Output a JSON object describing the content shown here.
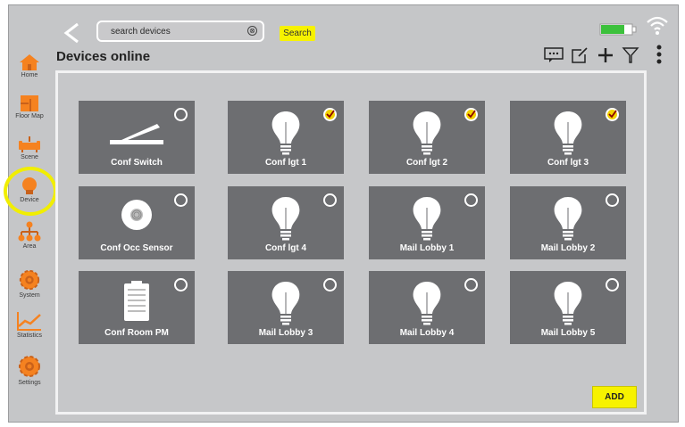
{
  "header": {
    "search_placeholder": "search devices",
    "search_button": "Search",
    "title": "Devices online"
  },
  "sidebar": {
    "items": [
      {
        "label": "Home",
        "icon": "home-icon"
      },
      {
        "label": "Floor Map",
        "icon": "floor-map-icon"
      },
      {
        "label": "Scene",
        "icon": "scene-icon"
      },
      {
        "label": "Device",
        "icon": "device-icon",
        "active": true
      },
      {
        "label": "Area",
        "icon": "area-icon"
      },
      {
        "label": "System",
        "icon": "system-gear-icon"
      },
      {
        "label": "Statistics",
        "icon": "statistics-icon"
      },
      {
        "label": "Settings",
        "icon": "settings-gear-icon"
      }
    ]
  },
  "toolbar_icons": [
    "message-icon",
    "edit-icon",
    "plus-icon",
    "filter-icon",
    "more-vertical-icon"
  ],
  "devices": [
    {
      "label": "Conf Switch",
      "type": "switch",
      "checked": false
    },
    {
      "label": "Conf lgt 1",
      "type": "bulb",
      "checked": true
    },
    {
      "label": "Conf lgt 2",
      "type": "bulb",
      "checked": true
    },
    {
      "label": "Conf lgt 3",
      "type": "bulb",
      "checked": true
    },
    {
      "label": "Conf Occ Sensor",
      "type": "sensor",
      "checked": false
    },
    {
      "label": "Conf lgt 4",
      "type": "bulb",
      "checked": false
    },
    {
      "label": "Mail Lobby 1",
      "type": "bulb",
      "checked": false
    },
    {
      "label": "Mail Lobby 2",
      "type": "bulb",
      "checked": false
    },
    {
      "label": "Conf Room PM",
      "type": "power-meter",
      "checked": false
    },
    {
      "label": "Mail Lobby 3",
      "type": "bulb",
      "checked": false
    },
    {
      "label": "Mail Lobby 4",
      "type": "bulb",
      "checked": false
    },
    {
      "label": "Mail Lobby 5",
      "type": "bulb",
      "checked": false
    }
  ],
  "add_button": "ADD",
  "colors": {
    "accent_yellow": "#f7f200",
    "tile": "#6d6e71",
    "icon_orange": "#f58220",
    "battery_green": "#3cc13c"
  }
}
